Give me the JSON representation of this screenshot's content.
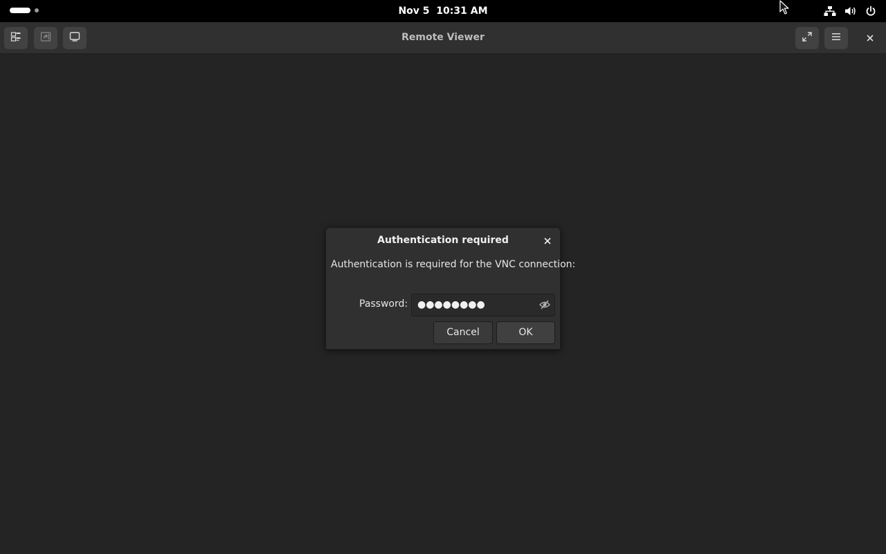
{
  "topbar": {
    "date": "Nov 5",
    "time": "10:31 AM",
    "icons": [
      "network-wired-icon",
      "volume-icon",
      "power-icon"
    ]
  },
  "headerbar": {
    "title": "Remote Viewer",
    "left_buttons": [
      "window-list-icon",
      "send-keys-icon",
      "display-icon"
    ],
    "right_buttons": [
      "fullscreen-icon",
      "hamburger-menu-icon",
      "close-icon"
    ]
  },
  "dialog": {
    "title": "Authentication required",
    "message": "Authentication is required for the VNC connection:",
    "password_label": "Password:",
    "password_value": "●●●●●●●●",
    "cancel_label": "Cancel",
    "ok_label": "OK"
  },
  "colors": {
    "background": "#242424",
    "topbar": "#000000",
    "headerbar": "#303030",
    "dialog": "#303030"
  }
}
